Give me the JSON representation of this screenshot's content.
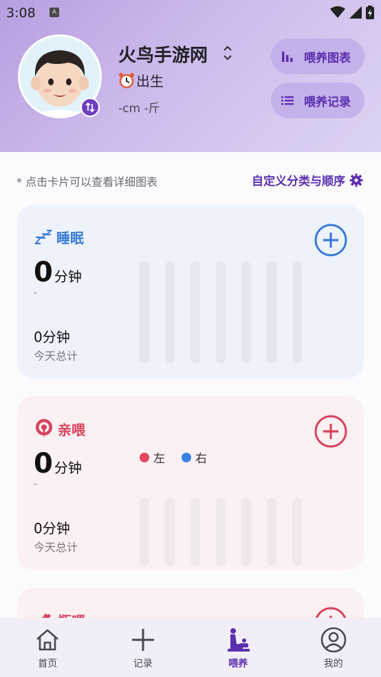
{
  "status": {
    "time": "3:08",
    "notif_glyph": "A"
  },
  "header": {
    "baby_name": "火鸟手游网",
    "birth_text": "出生",
    "measure_text": "-cm -斤",
    "chart_button": "喂养图表",
    "record_button": "喂养记录"
  },
  "content": {
    "hint": "* 点击卡片可以查看详细图表",
    "custom_link": "自定义分类与顺序"
  },
  "sleep_card": {
    "title": "睡眠",
    "big_number": "0",
    "big_unit": "分钟",
    "sub": "-",
    "total": "0分钟",
    "total_label": "今天总计"
  },
  "breast_card": {
    "title": "亲喂",
    "big_number": "0",
    "big_unit": "分钟",
    "sub": "-",
    "total": "0分钟",
    "total_label": "今天总计",
    "legend_left": "左",
    "legend_right": "右"
  },
  "bottle_card": {
    "title": "瓶喂"
  },
  "tabs": [
    {
      "label": "首页"
    },
    {
      "label": "记录"
    },
    {
      "label": "喂养"
    },
    {
      "label": "我的"
    }
  ],
  "colors": {
    "accent": "#5b2fae",
    "sleep": "#3b7bd8",
    "breast": "#d8425e",
    "legend_left": "#e4455f",
    "legend_right": "#3b82e6"
  }
}
